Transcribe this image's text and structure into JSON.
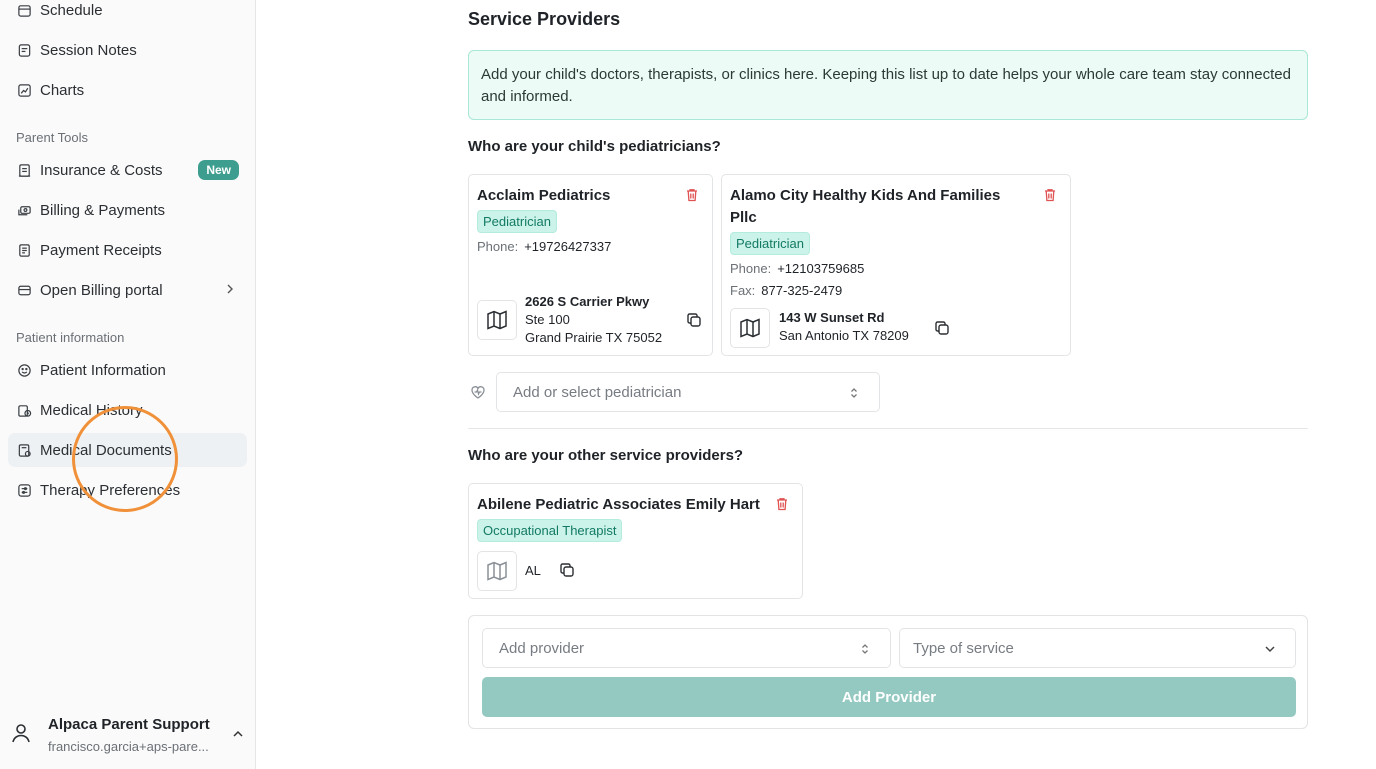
{
  "sidebar": {
    "top_items": [
      {
        "label": "Schedule",
        "icon": "calendar-icon"
      },
      {
        "label": "Session Notes",
        "icon": "notes-icon"
      },
      {
        "label": "Charts",
        "icon": "chart-icon"
      }
    ],
    "parent_tools_label": "Parent Tools",
    "parent_tools": [
      {
        "label": "Insurance & Costs",
        "badge": "New"
      },
      {
        "label": "Billing & Payments"
      },
      {
        "label": "Payment Receipts"
      },
      {
        "label": "Open Billing portal"
      }
    ],
    "patient_info_label": "Patient information",
    "patient_items": [
      {
        "label": "Patient Information"
      },
      {
        "label": "Medical History"
      },
      {
        "label": "Medical Documents"
      },
      {
        "label": "Therapy Preferences"
      }
    ],
    "user": {
      "name": "Alpaca Parent Support",
      "email": "francisco.garcia+aps-pare..."
    }
  },
  "main": {
    "title": "Service Providers",
    "info": "Add your child's doctors, therapists, or clinics here. Keeping this list up to date helps your whole care team stay connected and informed.",
    "pediatricians_label": "Who are your child's pediatricians?",
    "pediatricians": [
      {
        "name": "Acclaim Pediatrics",
        "tag": "Pediatrician",
        "phone_label": "Phone:",
        "phone": "+19726427337",
        "address": [
          "2626 S Carrier Pkwy",
          "Ste 100",
          "Grand Prairie TX 75052"
        ]
      },
      {
        "name_line1": "Alamo City Healthy Kids And Families",
        "name_line2": "Pllc",
        "tag": "Pediatrician",
        "phone_label": "Phone:",
        "phone": "+12103759685",
        "fax_label": "Fax:",
        "fax": "877-325-2479",
        "address": [
          "143 W Sunset Rd",
          "San Antonio TX 78209"
        ]
      }
    ],
    "pediatrician_select_placeholder": "Add or select pediatrician",
    "other_label": "Who are your other service providers?",
    "other_providers": [
      {
        "name": "Abilene Pediatric Associates Emily Hart",
        "tag": "Occupational Therapist",
        "address": [
          "AL"
        ]
      }
    ],
    "add_provider_placeholder": "Add provider",
    "service_type_placeholder": "Type of service",
    "add_button": "Add Provider"
  },
  "colors": {
    "accent": "#3d9e8f",
    "info_bg": "#ecfbf6",
    "pill_bg": "#ccf3e9",
    "button_disabled": "#94c9c1",
    "cursor_ring": "#f0913a"
  }
}
